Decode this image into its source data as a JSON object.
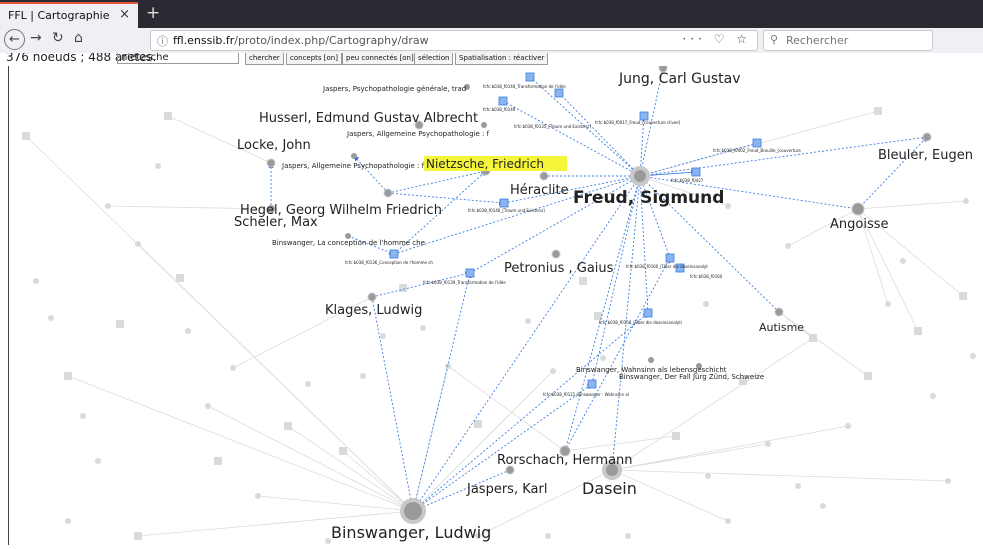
{
  "tab": {
    "title": "FFL | Cartographie",
    "close": "×",
    "new": "+"
  },
  "nav": {
    "url_host": "ffl.enssib.fr",
    "url_path": "/proto/index.php/Cartography/draw",
    "actions": "··· ♡ ☆",
    "search_placeholder": "Rechercher"
  },
  "toolbar": {
    "count": "376 noeuds ; 488 arêtes.",
    "query": "nietzsche",
    "buttons": [
      "chercher",
      "concepts [on]",
      "peu connectés [on]",
      "sélection",
      "Spatialisation : réactiver"
    ]
  },
  "graph": {
    "nodes_large": [
      {
        "id": "freud",
        "label": "Freud, Sigmund",
        "bold": true
      },
      {
        "id": "nietzsche",
        "label": "Nietzsche, Friedrich",
        "highlight": true
      },
      {
        "id": "jung",
        "label": "Jung, Carl Gustav"
      },
      {
        "id": "husserl",
        "label": "Husserl, Edmund Gustav Albrecht"
      },
      {
        "id": "locke",
        "label": "Locke, John"
      },
      {
        "id": "bleuler",
        "label": "Bleuler, Eugen"
      },
      {
        "id": "heraclite",
        "label": "Héraclite"
      },
      {
        "id": "hegel",
        "label": "Hegel, Georg Wilhelm Friedrich"
      },
      {
        "id": "scheler",
        "label": "Scheler, Max"
      },
      {
        "id": "angoisse",
        "label": "Angoisse"
      },
      {
        "id": "petronius",
        "label": "Petronius , Gaius"
      },
      {
        "id": "klages",
        "label": "Klages, Ludwig"
      },
      {
        "id": "autisme",
        "label": "Autisme"
      },
      {
        "id": "rorschach",
        "label": "Rorschach, Hermann"
      },
      {
        "id": "jaspers",
        "label": "Jaspers, Karl"
      },
      {
        "id": "dasein",
        "label": "Dasein"
      },
      {
        "id": "binswanger",
        "label": "Binswanger, Ludwig"
      }
    ],
    "nodes_small": [
      {
        "id": "jp_psycho",
        "label": "Jaspers, Psychopathologie générale, trad"
      },
      {
        "id": "jp_allg1",
        "label": "Jaspers, Allgemeine Psychopathologie : f"
      },
      {
        "id": "jp_allg2",
        "label": "Jaspers, Allgemeine Psychopathologie : f"
      },
      {
        "id": "bw_concept",
        "label": "Binswanger, La conception de l'homme che"
      },
      {
        "id": "bw_wahnsinn",
        "label": "Binswanger, Wahnsinn als lebensgeschicht"
      },
      {
        "id": "bw_fall",
        "label": "Binswanger, Der Fall Jürg Zünd, Schweize"
      }
    ],
    "nodes_tiny": [
      {
        "id": "f140",
        "label": "fcfc:b038_f0140_Transformation de l'idée"
      },
      {
        "id": "f149",
        "label": "fcfc:b038_f0149"
      },
      {
        "id": "f017",
        "label": "fcfc:b038_f0017_Freud_[couverture clivee]"
      },
      {
        "id": "f135",
        "label": "fcfc:b038_f0135_[Traum und Existenz]"
      },
      {
        "id": "f402",
        "label": "fcfc:b038_f0402_Freud_Brouille_[couverture"
      },
      {
        "id": "f427",
        "label": "fcfc:b038_f0427"
      },
      {
        "id": "f146",
        "label": "fcfc:b038_f0146_[Traum und Existenz]"
      },
      {
        "id": "f136",
        "label": "fcfc:b038_f0136_Conception de l'homme ch"
      },
      {
        "id": "f160",
        "label": "fcfc:b038_f0160_[Über die daseinsanalyt"
      },
      {
        "id": "f160b",
        "label": "fcfc:b038_f0160"
      },
      {
        "id": "f139",
        "label": "fcfc:b038_f0139_Transformation de l'idée"
      },
      {
        "id": "f158",
        "label": "fcfc:b038_f0158_[Über die daseinsanalyti"
      },
      {
        "id": "f121",
        "label": "fcfc:b038_f0121_Binswanger : Wahnsinn al"
      }
    ]
  }
}
